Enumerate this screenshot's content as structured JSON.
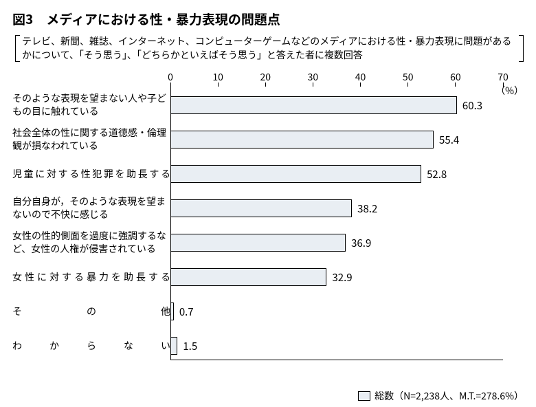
{
  "title": "図3　メディアにおける性・暴力表現の問題点",
  "subtitle": "テレビ、新聞、雑誌、インターネット、コンピューターゲームなどのメディアにおける性・暴力表現に問題があるかについて、「そう思う」、「どちらかといえばそう思う」と答えた者に複数回答",
  "unit": "（%）",
  "legend": "総数（N=2,238人、M.T.=278.6%）",
  "chart_data": {
    "type": "bar",
    "xlabel": "",
    "ylabel": "",
    "ylim": [
      0,
      70
    ],
    "ticks": [
      0,
      10,
      20,
      30,
      40,
      50,
      60,
      70
    ],
    "categories": [
      "そのような表現を望まない人や子どもの目に触れている",
      "社会全体の性に関する道徳感・倫理観が損なわれている",
      "児童に対する性犯罪を助長する",
      "自分自身が，そのような表現を望まないので不快に感じる",
      "女性の性的側面を過度に強調するなど、女性の人権が侵害されている",
      "女性に対する暴力を助長する",
      "その他",
      "わからない"
    ],
    "values": [
      60.3,
      55.4,
      52.8,
      38.2,
      36.9,
      32.9,
      0.7,
      1.5
    ],
    "title": ""
  },
  "justifyRows": [
    2,
    5,
    6,
    7
  ]
}
